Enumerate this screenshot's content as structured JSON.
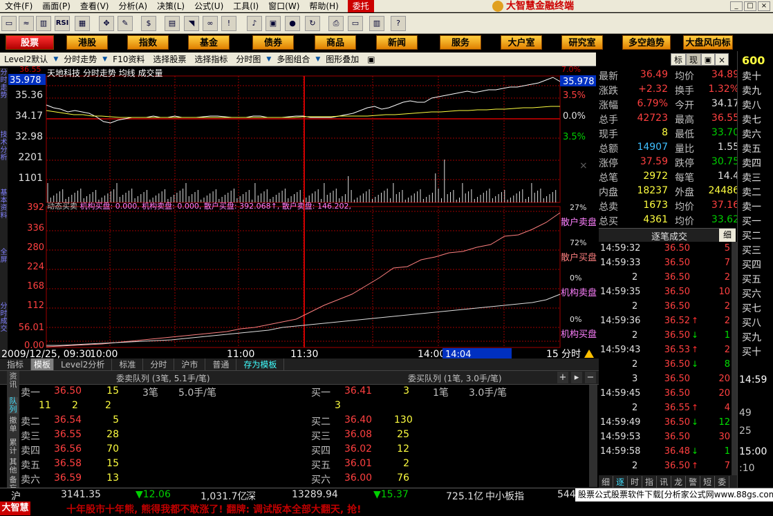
{
  "menu": {
    "items": [
      "文件(F)",
      "画面(P)",
      "查看(V)",
      "分析(A)",
      "决策(L)",
      "公式(U)",
      "工具(I)",
      "窗口(W)",
      "帮助(H)"
    ],
    "trade": "委托",
    "brand": "大智慧金融终端"
  },
  "nav": {
    "items": [
      "股票",
      "港股",
      "指数",
      "基金",
      "债券",
      "商品",
      "新闻",
      "服务",
      "大户室",
      "研究室",
      "多空趋势",
      "大盘风向标"
    ],
    "active": "股票"
  },
  "subbar": {
    "items": [
      "Level2默认",
      "分时走势",
      "F10资料",
      "选择股票",
      "选择指标",
      "分时图",
      "多图组合",
      "图形叠加"
    ],
    "right_tabs": [
      "标",
      "现"
    ]
  },
  "left_tabs": [
    "分时走势",
    "技术分析",
    "基本资料",
    "全屏",
    "分时成交"
  ],
  "chart": {
    "title": "天地科技  分时走势  均线  成交量",
    "price_axis_left": [
      "35.978",
      "35.36",
      "34.17",
      "32.98",
      "2201",
      "1101"
    ],
    "price_top_cut": "36.55",
    "price_axis_right": [
      "35.978",
      "3.5%",
      "0.0%",
      "3.5%"
    ],
    "right_top_cut": "7.0%",
    "lower_title": "动态买卖",
    "lower_metrics": "机构买盘: 0.000, 机构卖盘: 0.000, 散户买盘: 392.068↑, 散户卖盘: 146.202,",
    "lower_axis": [
      "392",
      "336",
      "280",
      "224",
      "168",
      "112",
      "56.01",
      "0.00"
    ],
    "lower_right": [
      {
        "pct": "27%",
        "name": "散户卖盘"
      },
      {
        "pct": "72%",
        "name": "散户买盘"
      },
      {
        "pct": "0%",
        "name": "机构卖盘"
      },
      {
        "pct": "0%",
        "name": "机构买盘"
      }
    ],
    "time_axis": [
      "2009/12/25, 09:30",
      "10:00",
      "11:00",
      "11:30",
      "14:00",
      "15",
      "分时"
    ],
    "cursor_time": "14:04"
  },
  "quote": [
    {
      "k1": "最新",
      "v1": "36.49",
      "k2": "均价",
      "v2": "34.89"
    },
    {
      "k1": "涨跌",
      "v1": "+2.32",
      "k2": "换手",
      "v2": "1.32%"
    },
    {
      "k1": "涨幅",
      "v1": "6.79%",
      "k2": "今开",
      "v2": "34.17"
    },
    {
      "k1": "总手",
      "v1": "42723",
      "k2": "最高",
      "v2": "36.55"
    },
    {
      "k1": "现手",
      "v1": "8",
      "k2": "最低",
      "v2": "33.70"
    },
    {
      "k1": "总额",
      "v1": "14907",
      "k2": "量比",
      "v2": "1.55"
    },
    {
      "k1": "涨停",
      "v1": "37.59",
      "k2": "跌停",
      "v2": "30.75"
    },
    {
      "k1": "总笔",
      "v1": "2972",
      "k2": "每笔",
      "v2": "14.4"
    },
    {
      "k1": "内盘",
      "v1": "18237",
      "k2": "外盘",
      "v2": "24486"
    },
    {
      "k1": "总卖",
      "v1": "1673",
      "k2": "均价",
      "v2": "37.16"
    },
    {
      "k1": "总买",
      "v1": "4361",
      "k2": "均价",
      "v2": "33.62"
    }
  ],
  "ticks_title": "逐笔成交",
  "ticks_detail": "细",
  "ticks": [
    {
      "t": "14:59:32",
      "c": "",
      "p": "36.50",
      "a": "",
      "v": "5"
    },
    {
      "t": "14:59:33",
      "c": "",
      "p": "36.50",
      "a": "",
      "v": "7"
    },
    {
      "t": "",
      "c": "2",
      "p": "36.50",
      "a": "",
      "v": "2"
    },
    {
      "t": "14:59:35",
      "c": "",
      "p": "36.50",
      "a": "",
      "v": "10"
    },
    {
      "t": "",
      "c": "2",
      "p": "36.50",
      "a": "",
      "v": "2"
    },
    {
      "t": "14:59:36",
      "c": "",
      "p": "36.52",
      "a": "up",
      "v": "2"
    },
    {
      "t": "",
      "c": "2",
      "p": "36.50",
      "a": "down",
      "v": "1"
    },
    {
      "t": "14:59:43",
      "c": "",
      "p": "36.53",
      "a": "up",
      "v": "2"
    },
    {
      "t": "",
      "c": "2",
      "p": "36.50",
      "a": "down",
      "v": "8"
    },
    {
      "t": "",
      "c": "3",
      "p": "36.50",
      "a": "",
      "v": "20"
    },
    {
      "t": "14:59:45",
      "c": "",
      "p": "36.50",
      "a": "",
      "v": "20"
    },
    {
      "t": "",
      "c": "2",
      "p": "36.55",
      "a": "up",
      "v": "4"
    },
    {
      "t": "14:59:49",
      "c": "",
      "p": "36.50",
      "a": "down",
      "v": "12"
    },
    {
      "t": "14:59:53",
      "c": "",
      "p": "36.50",
      "a": "",
      "v": "30"
    },
    {
      "t": "14:59:58",
      "c": "",
      "p": "36.48",
      "a": "down",
      "v": "1"
    },
    {
      "t": "",
      "c": "2",
      "p": "36.50",
      "a": "up",
      "v": "7"
    }
  ],
  "bottom_tabs_right": [
    "细",
    "逐",
    "时",
    "指",
    "讯",
    "龙",
    "警",
    "短",
    "委"
  ],
  "far_right": {
    "code": "600",
    "levels": [
      "卖十",
      "卖九",
      "卖八",
      "卖七",
      "卖六",
      "卖五",
      "卖四",
      "卖三",
      "卖二",
      "卖一",
      "买一",
      "买二",
      "买三",
      "买四",
      "买五",
      "买六",
      "买七",
      "买八",
      "买九",
      "买十"
    ],
    "times": [
      "14:59",
      "",
      "49",
      "25",
      "",
      "15:00",
      ":10"
    ]
  },
  "lower_bar": [
    "指标",
    "模板",
    "Level2分析",
    "标准",
    "分时",
    "沪市",
    "普通",
    "存为模板"
  ],
  "queue": {
    "sell_title": "委卖队列 (3笔, 5.1手/笔)",
    "buy_title": "委买队列 (1笔, 3.0手/笔)",
    "left_tabs": [
      "资讯",
      "队列",
      "撤单",
      "累计",
      "其他",
      "备忘"
    ],
    "sell": [
      {
        "l": "卖一",
        "p": "36.50",
        "v": "15",
        "e1": "3笔",
        "e2": "5.0手/笔"
      },
      {
        "l": "卖二",
        "p": "36.54",
        "v": "5"
      },
      {
        "l": "卖三",
        "p": "36.55",
        "v": "28"
      },
      {
        "l": "卖四",
        "p": "36.56",
        "v": "70"
      },
      {
        "l": "卖五",
        "p": "36.58",
        "v": "15"
      },
      {
        "l": "卖六",
        "p": "36.59",
        "v": "13"
      }
    ],
    "sell_sub": [
      "11",
      "2",
      "2"
    ],
    "buy": [
      {
        "l": "买一",
        "p": "36.41",
        "v": "3",
        "e1": "1笔",
        "e2": "3.0手/笔"
      },
      {
        "l": "买二",
        "p": "36.40",
        "v": "130"
      },
      {
        "l": "买三",
        "p": "36.08",
        "v": "25"
      },
      {
        "l": "买四",
        "p": "36.02",
        "v": "12"
      },
      {
        "l": "买五",
        "p": "36.01",
        "v": "2"
      },
      {
        "l": "买六",
        "p": "36.00",
        "v": "76"
      }
    ],
    "buy_sub": [
      "3"
    ]
  },
  "status": {
    "sh": "沪",
    "sh_idx": "3141.35",
    "sh_chg": "▼12.06",
    "sh_amt": "1,031.7亿",
    "sz": "深",
    "sz_idx": "13289.94",
    "sz_chg": "▼15.37",
    "sz_amt": "725.1亿",
    "smb": "中小板指",
    "smb_val": "544",
    "ad": "股票公式股票软件下载[分析家公式网www.88gs.com]"
  },
  "ticker": {
    "logo": "大智慧",
    "text": "十年股市十年熊, 熊得我都不敢涨了! 翻牌: 调试版本全部大翻天, 抢!"
  },
  "colors": {
    "up": "#ff4040",
    "down": "#00d000",
    "price_line": "#ffffff",
    "avg_line": "#ffff40",
    "grid": "#a00000"
  }
}
